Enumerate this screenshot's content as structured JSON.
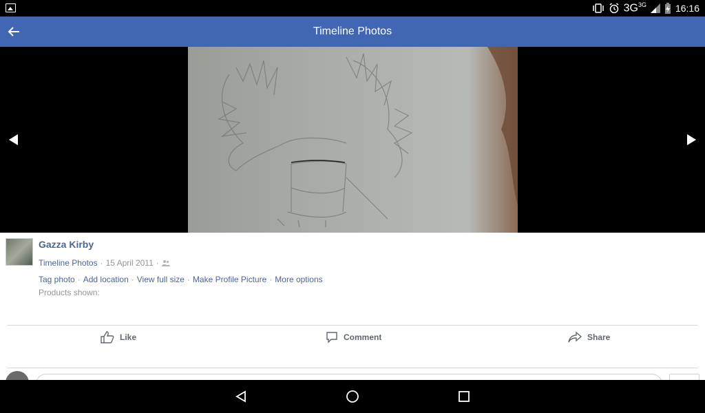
{
  "status_bar": {
    "network": "3G",
    "network_sup": "3G",
    "time": "16:16"
  },
  "app_bar": {
    "title": "Timeline Photos",
    "back_icon": "arrow-left-icon"
  },
  "viewer": {
    "prev_icon": "triangle-left-icon",
    "next_icon": "triangle-right-icon"
  },
  "post": {
    "author": "Gazza Kirby",
    "album": "Timeline Photos",
    "separator": "·",
    "date": "15 April 2011",
    "privacy_icon": "friends-icon",
    "links": [
      "Tag photo",
      "Add location",
      "View full size",
      "Make Profile Picture",
      "More options"
    ],
    "products_label": "Products shown:"
  },
  "reactions": {
    "like": "Like",
    "comment": "Comment",
    "share": "Share"
  },
  "colors": {
    "app_bar": "#4267b2",
    "link": "#4b6596",
    "muted": "#90949c"
  }
}
